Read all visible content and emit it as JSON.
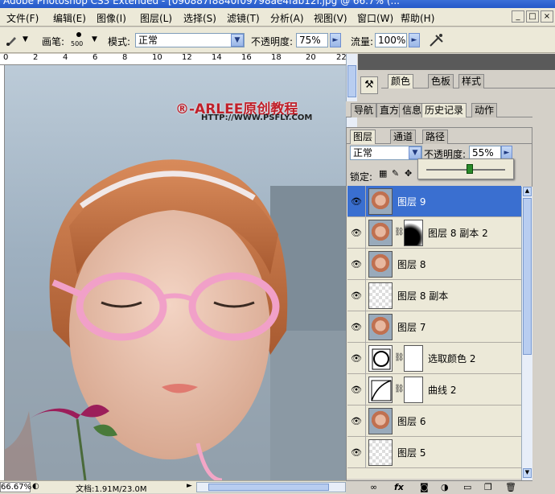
{
  "window": {
    "title": "Adobe Photoshop CS3 Extended - [090887f8840f09798ae4fab12f.jpg @ 66.7% (...",
    "min_label": "_",
    "restore_label": "□",
    "close_label": "×"
  },
  "menubar": {
    "items": [
      "文件(F)",
      "编辑(E)",
      "图像(I)",
      "图层(L)",
      "选择(S)",
      "滤镜(T)",
      "分析(A)",
      "视图(V)",
      "窗口(W)",
      "帮助(H)"
    ]
  },
  "options_bar": {
    "brush_label": "画笔:",
    "brush_size": "500",
    "mode_label": "模式:",
    "mode_value": "正常",
    "opacity_label": "不透明度:",
    "opacity_value": "75%",
    "flow_label": "流量:",
    "flow_value": "100%"
  },
  "ruler": {
    "ticks": [
      "0",
      "2",
      "4",
      "6",
      "8",
      "10",
      "12",
      "14",
      "16",
      "18",
      "20",
      "22"
    ]
  },
  "canvas": {
    "watermark_title": "®-ARLEE原创教程",
    "watermark_url": "HTTP://WWW.PSFLY.COM"
  },
  "status_bar": {
    "zoom": "66.67%",
    "doc_info": "文档:1.91M/23.0M"
  },
  "dock": {
    "tabs": [
      "颜色",
      "色板",
      "样式"
    ]
  },
  "nav_panel": {
    "tabs": [
      "导航",
      "直方",
      "信息",
      "历史记录",
      "动作"
    ]
  },
  "layers_panel": {
    "tabs": [
      "图层",
      "通道",
      "路径"
    ],
    "blend_mode": "正常",
    "opacity_label": "不透明度:",
    "opacity_value": "55%",
    "lock_label": "锁定:",
    "layers": [
      {
        "name": "图层 9",
        "thumb": "photo",
        "selected": true,
        "mask": false
      },
      {
        "name": "图层 8 副本 2",
        "thumb": "photo",
        "selected": false,
        "mask": true
      },
      {
        "name": "图层 8",
        "thumb": "photo",
        "selected": false,
        "mask": false
      },
      {
        "name": "图层 8 副本",
        "thumb": "transparent",
        "selected": false,
        "mask": false
      },
      {
        "name": "图层 7",
        "thumb": "photo",
        "selected": false,
        "mask": false
      },
      {
        "name": "选取颜色 2",
        "thumb": "selective-color",
        "selected": false,
        "mask": true
      },
      {
        "name": "曲线 2",
        "thumb": "curves",
        "selected": false,
        "mask": true
      },
      {
        "name": "图层 6",
        "thumb": "photo",
        "selected": false,
        "mask": false
      },
      {
        "name": "图层 5",
        "thumb": "transparent",
        "selected": false,
        "mask": false
      }
    ],
    "footer_icons": [
      "link-icon",
      "fx-icon",
      "mask-icon",
      "adjustment-icon",
      "group-icon",
      "new-layer-icon",
      "trash-icon"
    ]
  },
  "colors": {
    "selection": "#3a6fd0",
    "titlebar": "#2558c8",
    "panel": "#d4d0c8",
    "watermark_red": "#c0202a"
  }
}
